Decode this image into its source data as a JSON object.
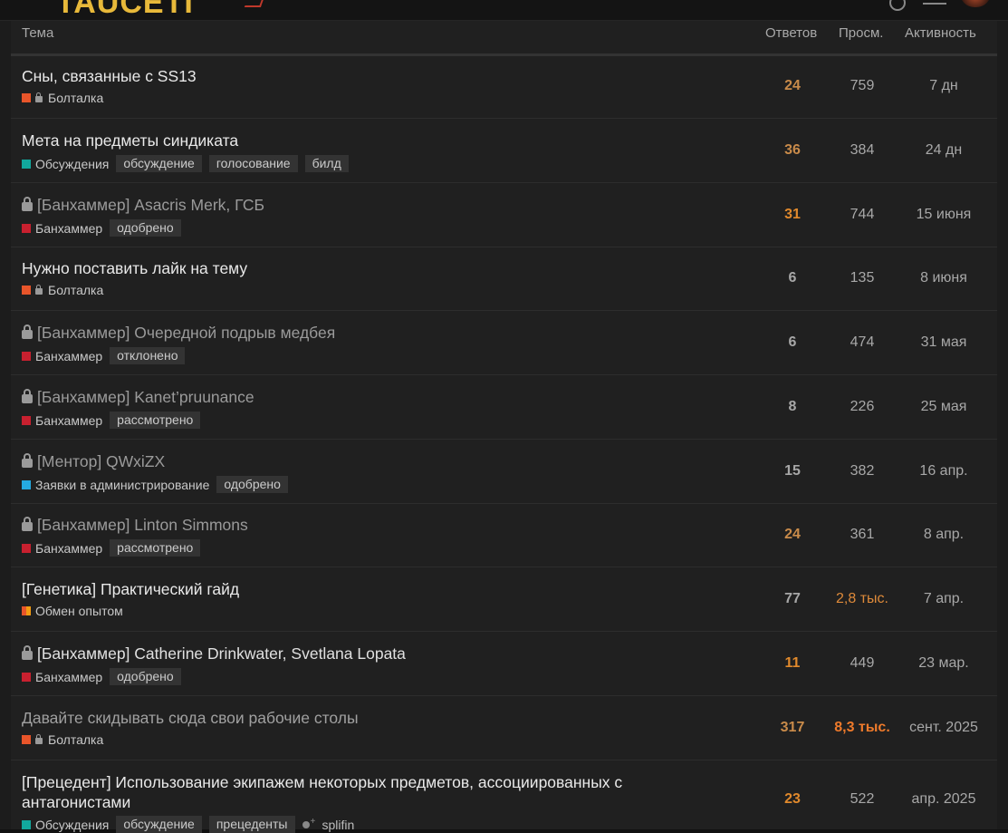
{
  "brand": {
    "logo_text": "TAUCETI"
  },
  "colors": {
    "accent": "#e8b93a",
    "cat_boltalka": "#e8552a",
    "cat_obsuzhdeniya": "#12a89d",
    "cat_banhammer": "#c8202f",
    "cat_zayavki": "#25aae1",
    "cat_obmen": "#f39c12"
  },
  "header": {
    "topic": "Тема",
    "replies": "Ответов",
    "views": "Просм.",
    "activity": "Активность"
  },
  "topics": [
    {
      "title": "Сны, связанные с SS13",
      "closed": false,
      "category": "Болталка",
      "cat_color": "#e8552a",
      "cat_locked": true,
      "tags": [],
      "replies": "24",
      "views": "759",
      "activity": "7 дн"
    },
    {
      "title": "Мета на предметы синдиката",
      "closed": false,
      "category": "Обсуждения",
      "cat_color": "#12a89d",
      "cat_locked": false,
      "tags": [
        "обсуждение",
        "голосование",
        "билд"
      ],
      "replies": "36",
      "views": "384",
      "activity": "24 дн"
    },
    {
      "title": "[Банхаммер] Asacris Merk, ГСБ",
      "closed": true,
      "category": "Банхаммер",
      "cat_color": "#c8202f",
      "cat_locked": false,
      "tags": [
        "одобрено"
      ],
      "replies": "31",
      "views": "744",
      "activity": "15 июня"
    },
    {
      "title": "Нужно поставить лайк на тему",
      "closed": false,
      "category": "Болталка",
      "cat_color": "#e8552a",
      "cat_locked": true,
      "tags": [],
      "replies": "6",
      "views": "135",
      "activity": "8 июня"
    },
    {
      "title": "[Банхаммер] Очередной подрыв медбея",
      "closed": true,
      "category": "Банхаммер",
      "cat_color": "#c8202f",
      "cat_locked": false,
      "tags": [
        "отклонено"
      ],
      "replies": "6",
      "views": "474",
      "activity": "31 мая"
    },
    {
      "title": "[Банхаммер] Kanet’pruunance",
      "closed": true,
      "category": "Банхаммер",
      "cat_color": "#c8202f",
      "cat_locked": false,
      "tags": [
        "рассмотрено"
      ],
      "replies": "8",
      "views": "226",
      "activity": "25 мая"
    },
    {
      "title": "[Ментор] QWxiZX",
      "closed": true,
      "category": "Заявки в администрирование",
      "cat_color": "#25aae1",
      "cat_locked": false,
      "tags": [
        "одобрено"
      ],
      "replies": "15",
      "views": "382",
      "activity": "16 апр."
    },
    {
      "title": "[Банхаммер] Linton Simmons",
      "closed": true,
      "category": "Банхаммер",
      "cat_color": "#c8202f",
      "cat_locked": false,
      "tags": [
        "рассмотрено"
      ],
      "replies": "24",
      "views": "361",
      "activity": "8 апр."
    },
    {
      "title": "[Генетика] Практический гайд",
      "closed": false,
      "category": "Обмен опытом",
      "cat_color": "#f39c12",
      "cat_locked": false,
      "tags": [],
      "replies": "77",
      "views": "2,8 тыс.",
      "activity": "7 апр."
    },
    {
      "title": "[Банхаммер] Catherine Drinkwater, Svetlana Lopata",
      "closed": true,
      "category": "Банхаммер",
      "cat_color": "#c8202f",
      "cat_locked": false,
      "tags": [
        "одобрено"
      ],
      "replies": "11",
      "views": "449",
      "activity": "23 мар."
    },
    {
      "title": "Давайте скидывать сюда свои рабочие столы",
      "closed": false,
      "category": "Болталка",
      "cat_color": "#e8552a",
      "cat_locked": true,
      "tags": [],
      "replies": "317",
      "views": "8,3 тыс.",
      "activity": "сент. 2025"
    },
    {
      "title_line1": "[Прецедент] Использование экипажем некоторых предметов, ассоциированных с",
      "title_line2": "антагонистами",
      "closed": false,
      "category": "Обсуждения",
      "cat_color": "#12a89d",
      "cat_locked": false,
      "tags": [
        "обсуждение",
        "прецеденты"
      ],
      "poster": "splifin",
      "replies": "23",
      "views": "522",
      "activity": "апр. 2025"
    }
  ]
}
